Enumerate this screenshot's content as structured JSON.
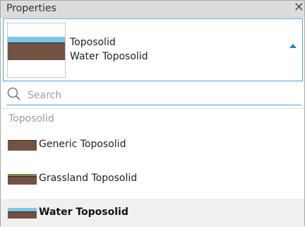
{
  "window": {
    "title": "Properties",
    "close_glyph": "✕"
  },
  "selector": {
    "category": "Toposolid",
    "type_name": "Water Toposolid"
  },
  "search": {
    "placeholder": "Search",
    "value": ""
  },
  "list": {
    "section": "Toposolid",
    "items": [
      {
        "label": "Generic Toposolid",
        "icon": "generic-toposolid-swatch-icon"
      },
      {
        "label": "Grassland Toposolid",
        "icon": "grassland-toposolid-swatch-icon"
      },
      {
        "label": "Water Toposolid",
        "icon": "water-toposolid-swatch-icon",
        "selected": true
      }
    ]
  },
  "colors": {
    "accent": "#1c86c8",
    "earth": "#725243",
    "water": "#7cc7e6",
    "grass": "#6e8f4e"
  }
}
